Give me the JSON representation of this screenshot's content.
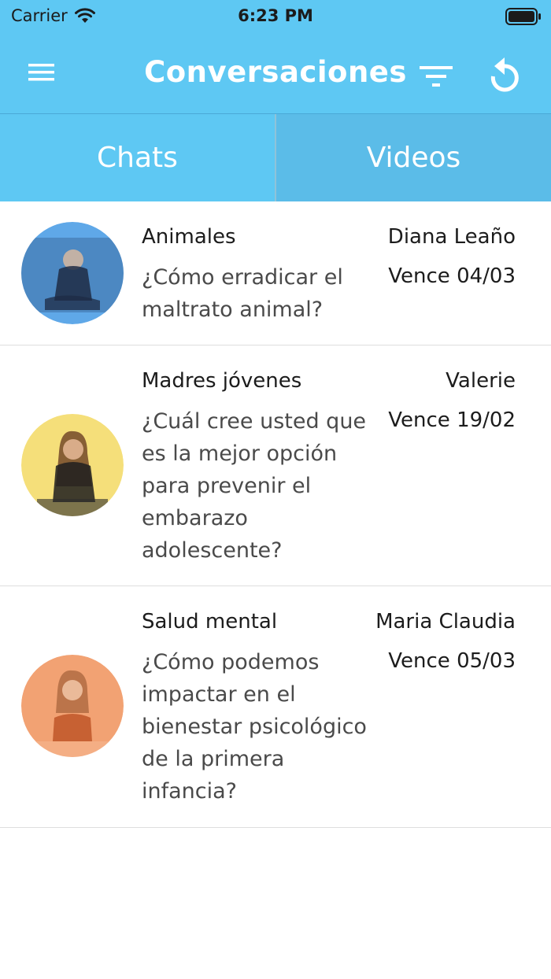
{
  "status_bar": {
    "carrier": "Carrier",
    "time": "6:23 PM",
    "wifi_icon": "wifi-icon",
    "battery_icon": "battery-icon"
  },
  "nav": {
    "title": "Conversaciones",
    "menu_icon": "hamburger-menu-icon",
    "filter_icon": "filter-icon",
    "refresh_icon": "refresh-icon"
  },
  "tabs": [
    {
      "label": "Chats",
      "selected": true
    },
    {
      "label": "Videos",
      "selected": false
    }
  ],
  "conversations": [
    {
      "topic": "Animales",
      "question": "¿Cómo erradicar el maltrato animal?",
      "author": "Diana Leaño",
      "due": "Vence 04/03",
      "avatar_tint": "#5fa8e8"
    },
    {
      "topic": "Madres jóvenes",
      "question": "¿Cuál cree usted que es la mejor opción para prevenir el embarazo adolescente?",
      "author": "Valerie",
      "due": "Vence 19/02",
      "avatar_tint": "#f5df7a"
    },
    {
      "topic": "Salud mental",
      "question": "¿Cómo podemos impactar en el bienestar psicológico de la primera infancia?",
      "author": "Maria Claudia",
      "due": "Vence 05/03",
      "avatar_tint": "#f2a273"
    }
  ],
  "colors": {
    "primary": "#5ec8f3",
    "tab_selected_bg": "#5ec8f3",
    "tab_unselected_bg": "#5bbce8",
    "text_primary": "#1c1c1c",
    "text_secondary": "#4a4a4a",
    "divider": "#dedede"
  }
}
